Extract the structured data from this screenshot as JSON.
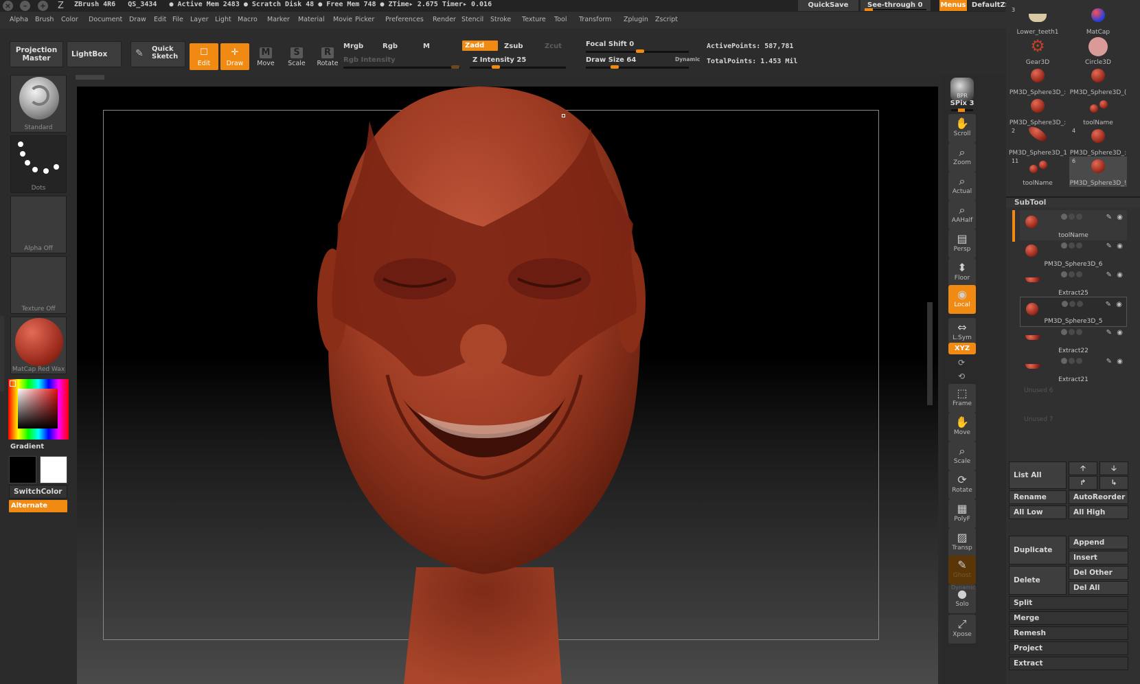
{
  "window": {
    "app_label": "ZBrush 4R6",
    "status_text": "QS_3434   ● Active Mem 2483 ● Scratch Disk 48 ● Free Mem 748 ● ZTime▸ 2.675 Timer▸ 0.016",
    "quicksave": "QuickSave",
    "see_through": "See-through  0",
    "menus": "Menus",
    "default_script": "DefaultZScript"
  },
  "menubar": [
    "Alpha",
    "Brush",
    "Color",
    "Document",
    "Draw",
    "Edit",
    "File",
    "Layer",
    "Light",
    "Macro",
    "Marker",
    "Material",
    "Movie",
    "Picker",
    "Preferences",
    "Render",
    "Stencil",
    "Stroke",
    "Texture",
    "Tool",
    "Transform",
    "Zplugin",
    "Zscript"
  ],
  "toolbar": {
    "projection_master": "Projection\nMaster",
    "lightbox": "LightBox",
    "quick_sketch": "Quick\nSketch",
    "modes": [
      {
        "label": "Edit",
        "icon": "edit-icon",
        "glyph": "☐",
        "on": true
      },
      {
        "label": "Draw",
        "icon": "draw-icon",
        "glyph": "✛",
        "on": true
      },
      {
        "label": "Move",
        "icon": "move-icon",
        "glyph": "M",
        "on": false
      },
      {
        "label": "Scale",
        "icon": "scale-icon",
        "glyph": "S",
        "on": false
      },
      {
        "label": "Rotate",
        "icon": "rotate-icon",
        "glyph": "R",
        "on": false
      }
    ],
    "mrgb": "Mrgb",
    "rgb": "Rgb",
    "m": "M",
    "rgb_intensity": "Rgb Intensity",
    "zadd": "Zadd",
    "zsub": "Zsub",
    "zcut": "Zcut",
    "z_intensity": "Z Intensity 25",
    "z_intensity_value": 25,
    "focal_shift": "Focal Shift 0",
    "draw_size": "Draw Size 64",
    "dynamic": "Dynamic",
    "active_points": "ActivePoints: 587,781",
    "total_points": "TotalPoints: 1.453 Mil"
  },
  "left": {
    "brush": "Standard",
    "stroke": "Dots",
    "alpha": "Alpha Off",
    "texture": "Texture Off",
    "material": "MatCap Red Wax",
    "gradient": "Gradient",
    "switch_color": "SwitchColor",
    "alternate": "Alternate",
    "colors": {
      "main": "#000000",
      "secondary": "#ffffff",
      "accent": "#f08a12"
    }
  },
  "shelf": [
    {
      "label": "BPR",
      "glyph": "●",
      "icon": "bpr-icon"
    },
    {
      "label": "SPix 3",
      "glyph": "",
      "icon": "spix-slider"
    },
    {
      "label": "Scroll",
      "glyph": "✋",
      "icon": "scroll-icon"
    },
    {
      "label": "Zoom",
      "glyph": "⌕",
      "icon": "zoom-icon"
    },
    {
      "label": "Actual",
      "glyph": "⌕",
      "icon": "actual-icon"
    },
    {
      "label": "AAHalf",
      "glyph": "⌕",
      "icon": "aahalf-icon"
    },
    {
      "label": "Persp",
      "glyph": "▤",
      "icon": "persp-icon"
    },
    {
      "label": "Floor",
      "glyph": "⬍",
      "icon": "floor-icon"
    },
    {
      "label": "Local",
      "glyph": "◉",
      "icon": "local-icon"
    },
    {
      "label": "L.Sym",
      "glyph": "⇔",
      "icon": "lsym-icon"
    },
    {
      "label": "XYZ",
      "glyph": "",
      "icon": "xyz-icon"
    },
    {
      "label": "Frame",
      "glyph": "⬚",
      "icon": "frame-icon"
    },
    {
      "label": "Move",
      "glyph": "✋",
      "icon": "move-view-icon"
    },
    {
      "label": "Scale",
      "glyph": "⌕",
      "icon": "scale-view-icon"
    },
    {
      "label": "Rotate",
      "glyph": "⟳",
      "icon": "rotate-view-icon"
    },
    {
      "label": "PolyF",
      "glyph": "▦",
      "icon": "polyf-icon"
    },
    {
      "label": "Transp",
      "glyph": "▨",
      "icon": "transp-icon"
    },
    {
      "label": "Ghost",
      "glyph": "✎",
      "icon": "ghost-icon"
    },
    {
      "label": "Solo",
      "glyph": "●",
      "icon": "solo-icon"
    },
    {
      "label": "Xpose",
      "glyph": "⤢",
      "icon": "xpose-icon"
    }
  ],
  "dynamic_label": "Dynamic",
  "tools": [
    {
      "name": "Lower_teeth1",
      "badge": "3"
    },
    {
      "name": "MatCap",
      "badge": ""
    },
    {
      "name": "Gear3D",
      "badge": ""
    },
    {
      "name": "Circle3D",
      "badge": ""
    },
    {
      "name": "PM3D_Sphere3D_:",
      "badge": ""
    },
    {
      "name": "PM3D_Sphere3D_(",
      "badge": ""
    },
    {
      "name": "PM3D_Sphere3D_:",
      "badge": ""
    },
    {
      "name": "toolName",
      "badge": ""
    },
    {
      "name": "PM3D_Sphere3D_1",
      "badge": "2"
    },
    {
      "name": "PM3D_Sphere3D_:",
      "badge": "4"
    },
    {
      "name": "toolName",
      "badge": "11"
    },
    {
      "name": "PM3D_Sphere3D_!",
      "badge": "6"
    }
  ],
  "subtool": {
    "title": "SubTool",
    "items": [
      "toolName",
      "PM3D_Sphere3D_6",
      "Extract25",
      "PM3D_Sphere3D_5",
      "Extract22",
      "Extract21"
    ],
    "unused": [
      "Unused 6",
      "Unused 7"
    ],
    "buttons": {
      "list_all": "List All",
      "rename": "Rename",
      "auto_reorder": "AutoReorder",
      "all_low": "All Low",
      "all_high": "All High",
      "duplicate": "Duplicate",
      "append": "Append",
      "insert": "Insert",
      "delete": "Delete",
      "del_other": "Del Other",
      "del_all": "Del All",
      "split": "Split",
      "merge": "Merge",
      "remesh": "Remesh",
      "project": "Project",
      "extract": "Extract"
    }
  }
}
